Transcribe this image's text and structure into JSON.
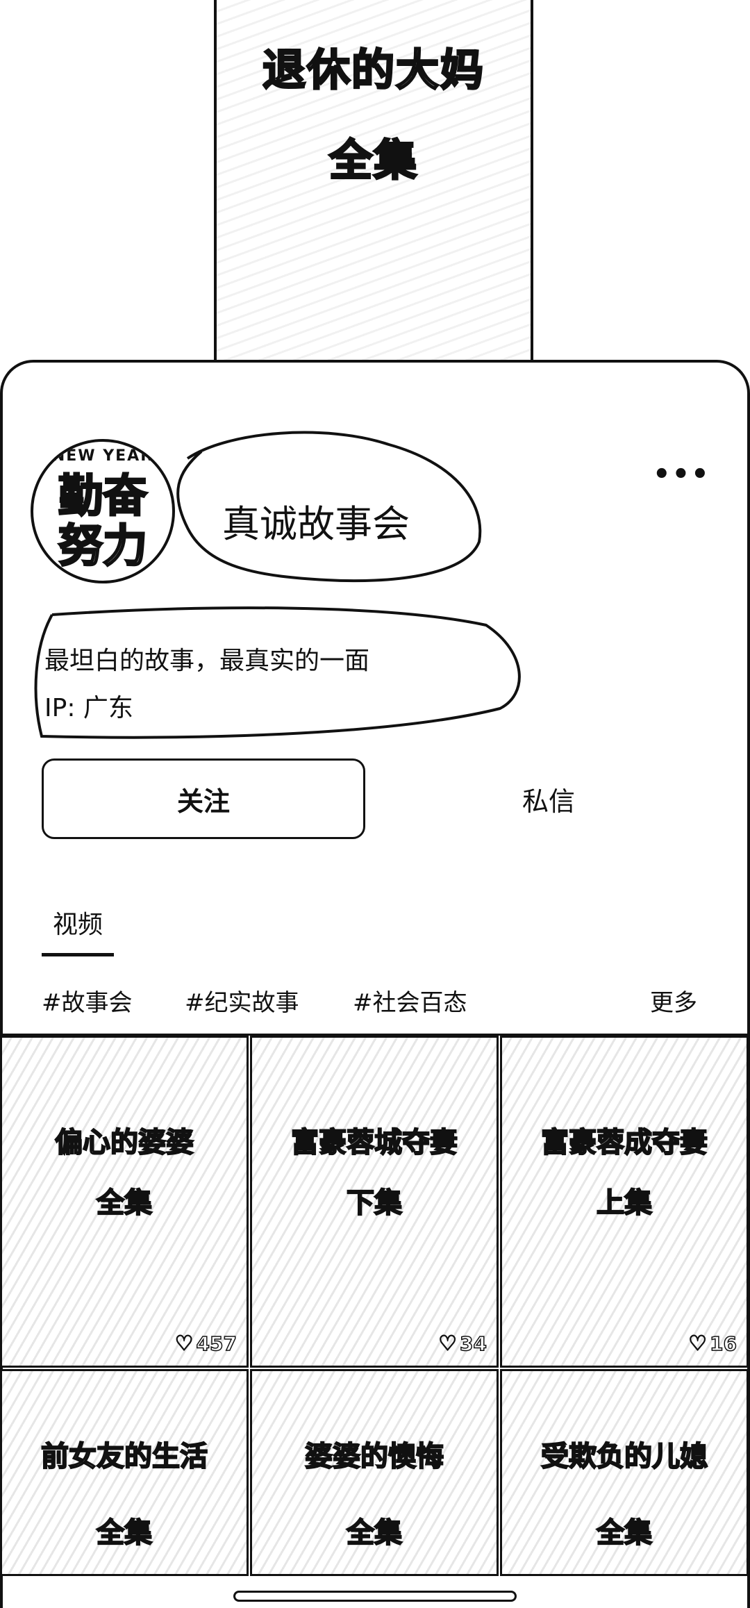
{
  "hero": {
    "title_line1": "退休的大妈",
    "title_line2": "全集"
  },
  "profile": {
    "avatar_top_text": "NEW YEAR",
    "avatar_line1": "勤奋",
    "avatar_line2": "努力",
    "name": "真诚故事会",
    "bio": "最坦白的故事，最真实的一面",
    "ip": "IP: 广东",
    "more_icon": "more-dots-icon"
  },
  "actions": {
    "follow_label": "关注",
    "message_label": "私信"
  },
  "tabs": {
    "video_label": "视频"
  },
  "tags": {
    "items": [
      "#故事会",
      "#纪实故事",
      "#社会百态"
    ],
    "more_label": "更多"
  },
  "videos": [
    {
      "title": "偏心的婆婆",
      "part": "全集",
      "likes": "457"
    },
    {
      "title": "富豪蓉城夺妻",
      "part": "下集",
      "likes": "34"
    },
    {
      "title": "富豪蓉成夺妻",
      "part": "上集",
      "likes": "16"
    },
    {
      "title": "前女友的生活",
      "part": "全集",
      "likes": ""
    },
    {
      "title": "婆婆的懊悔",
      "part": "全集",
      "likes": ""
    },
    {
      "title": "受欺负的儿媳",
      "part": "全集",
      "likes": ""
    }
  ],
  "colors": {
    "ink": "#111111",
    "background": "#ffffff"
  }
}
